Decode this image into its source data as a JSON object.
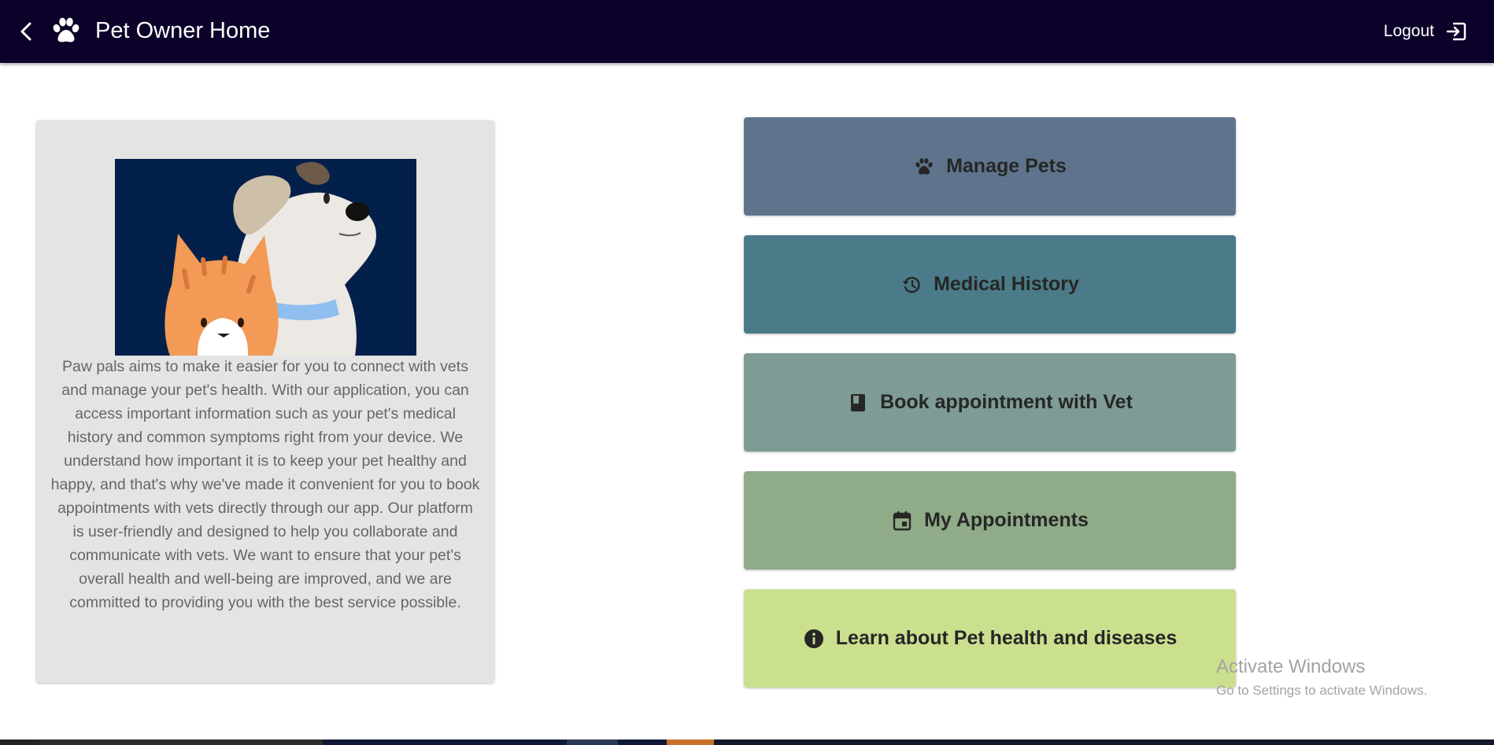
{
  "header": {
    "title": "Pet Owner Home",
    "logout_label": "Logout",
    "background_color": "#0c0229"
  },
  "info_card": {
    "text": "Paw pals aims to make it easier for you to connect with vets and manage your pet's health. With our application, you can access important information such as your pet's medical history and common symptoms right from your device. We understand how important it is to keep your pet healthy and happy, and that's why we've made it convenient for you to book appointments with vets directly through our app. Our platform is user-friendly and designed to help you collaborate and communicate with vets. We want to ensure that your pet's overall health and well-being are improved, and we are committed to providing you with the best service possible.",
    "image": "cat-and-dog-illustration"
  },
  "actions": [
    {
      "label": "Manage Pets",
      "icon": "paw-icon",
      "color": "#5f748c"
    },
    {
      "label": "Medical History",
      "icon": "history-icon",
      "color": "#4b7b88"
    },
    {
      "label": "Book appointment with Vet",
      "icon": "book-icon",
      "color": "#7e9b95"
    },
    {
      "label": "My Appointments",
      "icon": "calendar-icon",
      "color": "#8fab88"
    },
    {
      "label": "Learn about Pet health and diseases",
      "icon": "info-icon",
      "color": "#cbe08e"
    }
  ],
  "watermark": {
    "title": "Activate Windows",
    "subtitle": "Go to Settings to activate Windows."
  }
}
